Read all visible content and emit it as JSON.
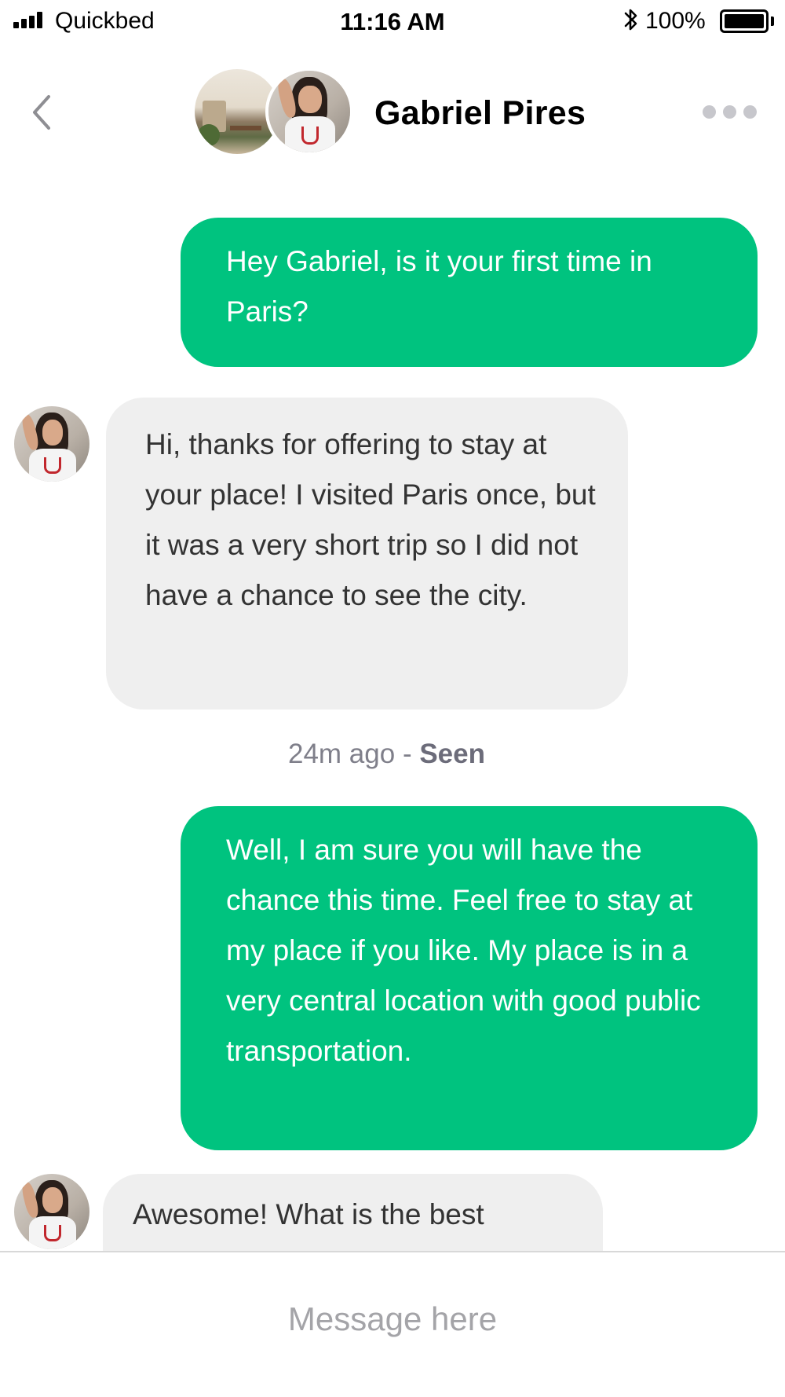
{
  "status_bar": {
    "carrier": "Quickbed",
    "time": "11:16 AM",
    "battery_percent": "100%",
    "battery_level": 1.0
  },
  "header": {
    "contact_name": "Gabriel Pires",
    "back_icon": "chevron-left-icon",
    "more_icon": "ellipsis-icon"
  },
  "messages": [
    {
      "direction": "sent",
      "text": "Hey Gabriel, is it your first time in Paris?"
    },
    {
      "direction": "received",
      "text": "Hi, thanks for offering to stay at your place! I visited Paris once, but it was a very short trip so I did not have a chance to see the city."
    },
    {
      "direction": "sent",
      "text": "Well, I am sure you will have the chance this time. Feel free to stay at my place if you like. My place is in a very central location with good public transportation."
    },
    {
      "direction": "received",
      "text": "Awesome! What is the best"
    }
  ],
  "receipt": {
    "time_ago": "24m ago",
    "separator": " - ",
    "status": "Seen"
  },
  "composer": {
    "placeholder": "Message here"
  },
  "colors": {
    "sent_bubble": "#00c37f",
    "received_bubble": "#efefef",
    "sent_text": "#ffffff",
    "received_text": "#333333"
  }
}
